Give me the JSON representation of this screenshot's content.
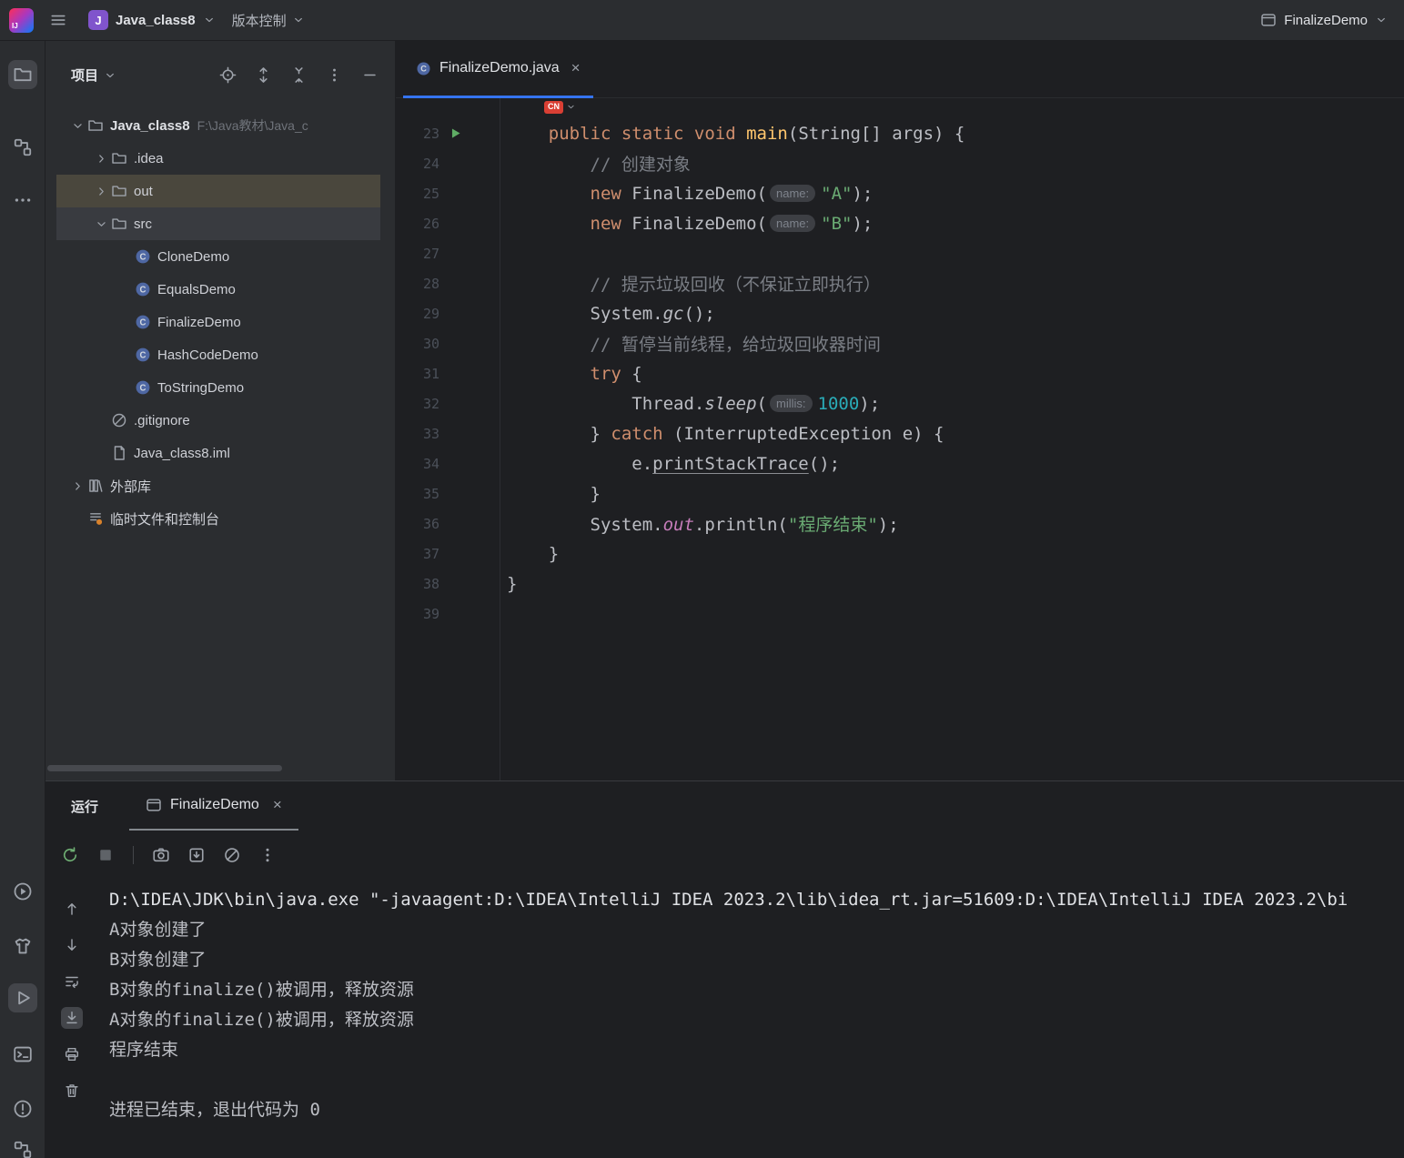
{
  "titlebar": {
    "project_badge": "J",
    "project_name": "Java_class8",
    "vcs_label": "版本控制",
    "run_config": "FinalizeDemo"
  },
  "colors": {
    "accent_blue": "#3574F0",
    "run_green": "#5FAD65",
    "keyword_orange": "#CF8E6D",
    "string_green": "#6AAB73",
    "ime_red": "#D93F34",
    "selection_gray": "#393B40",
    "selection_brown": "#4A473D"
  },
  "left_strip": {
    "top": [
      {
        "id": "project-tool-button",
        "icon": "folder",
        "active": true
      },
      {
        "id": "structure-tool-button",
        "icon": "structure",
        "active": false
      },
      {
        "id": "more-tool-windows-button",
        "icon": "moreDots",
        "active": false
      }
    ],
    "bottom": [
      {
        "id": "services-tool-button",
        "icon": "services",
        "active": false
      },
      {
        "id": "bookmarks-tool-button",
        "icon": "shirt",
        "active": false
      },
      {
        "id": "run-tool-button",
        "icon": "runPlay",
        "active": true
      },
      {
        "id": "terminal-tool-button",
        "icon": "terminal",
        "active": false
      },
      {
        "id": "problems-tool-button",
        "icon": "problems",
        "active": false
      },
      {
        "id": "cutoff-tool-button",
        "icon": "structure",
        "active": false
      }
    ]
  },
  "project_panel": {
    "title": "项目",
    "header_icons": [
      {
        "id": "select-opened-file-button",
        "icon": "target"
      },
      {
        "id": "expand-all-button",
        "icon": "expandAll"
      },
      {
        "id": "collapse-all-button",
        "icon": "collapseAll"
      },
      {
        "id": "more-options-button",
        "icon": "kebab"
      },
      {
        "id": "hide-panel-button",
        "icon": "minus"
      }
    ],
    "tree": [
      {
        "id": "java_class8-root",
        "label": "Java_class8",
        "hint": "F:\\Java教材\\Java_c",
        "icon": "folder",
        "depth": 0,
        "chevron": "down",
        "bold": true
      },
      {
        "id": "idea-folder",
        "label": ".idea",
        "icon": "folder",
        "depth": 1,
        "chevron": "right"
      },
      {
        "id": "out-folder",
        "label": "out",
        "icon": "folder",
        "depth": 1,
        "chevron": "right",
        "selected": "brown"
      },
      {
        "id": "src-folder",
        "label": "src",
        "icon": "folder",
        "depth": 1,
        "chevron": "down",
        "selected": "gray"
      },
      {
        "id": "clonedemo-class",
        "label": "CloneDemo",
        "icon": "class",
        "depth": 2
      },
      {
        "id": "equalsdemo-class",
        "label": "EqualsDemo",
        "icon": "class",
        "depth": 2
      },
      {
        "id": "finalizedemo-class",
        "label": "FinalizeDemo",
        "icon": "class",
        "depth": 2
      },
      {
        "id": "hashcodedemo-class",
        "label": "HashCodeDemo",
        "icon": "class",
        "depth": 2
      },
      {
        "id": "tostringdemo-class",
        "label": "ToStringDemo",
        "icon": "class",
        "depth": 2
      },
      {
        "id": "gitignore-file",
        "label": ".gitignore",
        "icon": "ignored",
        "depth": 1
      },
      {
        "id": "iml-file",
        "label": "Java_class8.iml",
        "icon": "file",
        "depth": 1
      },
      {
        "id": "external-libraries",
        "label": "外部库",
        "icon": "library",
        "depth": 0,
        "chevron": "right"
      },
      {
        "id": "scratches",
        "label": "临时文件和控制台",
        "icon": "scratch",
        "depth": 0
      }
    ]
  },
  "editor": {
    "tab_label": "FinalizeDemo.java",
    "ime_label": "CN",
    "lines": [
      {
        "no": 23,
        "run": true,
        "tokens": [
          {
            "t": "    ",
            "c": "p"
          },
          {
            "t": "public static void ",
            "c": "kw"
          },
          {
            "t": "main",
            "c": "fn"
          },
          {
            "t": "(String[] args) {",
            "c": "p"
          }
        ]
      },
      {
        "no": 24,
        "tokens": [
          {
            "t": "        ",
            "c": "p"
          },
          {
            "t": "// 创建对象",
            "c": "cm"
          }
        ]
      },
      {
        "no": 25,
        "tokens": [
          {
            "t": "        ",
            "c": "p"
          },
          {
            "t": "new",
            "c": "kw"
          },
          {
            "t": " FinalizeDemo(",
            "c": "p"
          },
          {
            "t": "name:",
            "c": "chip"
          },
          {
            "t": "\"A\"",
            "c": "st"
          },
          {
            "t": ");",
            "c": "p"
          }
        ]
      },
      {
        "no": 26,
        "tokens": [
          {
            "t": "        ",
            "c": "p"
          },
          {
            "t": "new",
            "c": "kw"
          },
          {
            "t": " FinalizeDemo(",
            "c": "p"
          },
          {
            "t": "name:",
            "c": "chip"
          },
          {
            "t": "\"B\"",
            "c": "st"
          },
          {
            "t": ");",
            "c": "p"
          }
        ]
      },
      {
        "no": 27,
        "tokens": []
      },
      {
        "no": 28,
        "tokens": [
          {
            "t": "        ",
            "c": "p"
          },
          {
            "t": "// 提示垃圾回收（不保证立即执行）",
            "c": "cm"
          }
        ]
      },
      {
        "no": 29,
        "tokens": [
          {
            "t": "        System.",
            "c": "p"
          },
          {
            "t": "gc",
            "c": "it"
          },
          {
            "t": "();",
            "c": "p"
          }
        ]
      },
      {
        "no": 30,
        "tokens": [
          {
            "t": "        ",
            "c": "p"
          },
          {
            "t": "// 暂停当前线程，给垃圾回收器时间",
            "c": "cm"
          }
        ]
      },
      {
        "no": 31,
        "tokens": [
          {
            "t": "        ",
            "c": "p"
          },
          {
            "t": "try",
            "c": "kw"
          },
          {
            "t": " {",
            "c": "p"
          }
        ]
      },
      {
        "no": 32,
        "tokens": [
          {
            "t": "            Thread.",
            "c": "p"
          },
          {
            "t": "sleep",
            "c": "it"
          },
          {
            "t": "(",
            "c": "p"
          },
          {
            "t": "millis:",
            "c": "chip"
          },
          {
            "t": "1000",
            "c": "nm"
          },
          {
            "t": ");",
            "c": "p"
          }
        ]
      },
      {
        "no": 33,
        "tokens": [
          {
            "t": "        } ",
            "c": "p"
          },
          {
            "t": "catch",
            "c": "kw"
          },
          {
            "t": " (InterruptedException e) {",
            "c": "p"
          }
        ]
      },
      {
        "no": 34,
        "tokens": [
          {
            "t": "            e.",
            "c": "p"
          },
          {
            "t": "printStackTrace",
            "c": "ul"
          },
          {
            "t": "();",
            "c": "p"
          }
        ]
      },
      {
        "no": 35,
        "tokens": [
          {
            "t": "        }",
            "c": "p"
          }
        ]
      },
      {
        "no": 36,
        "tokens": [
          {
            "t": "        System.",
            "c": "p"
          },
          {
            "t": "out",
            "c": "sf"
          },
          {
            "t": ".println(",
            "c": "p"
          },
          {
            "t": "\"程序结束\"",
            "c": "st"
          },
          {
            "t": ");",
            "c": "p"
          }
        ]
      },
      {
        "no": 37,
        "tokens": [
          {
            "t": "    }",
            "c": "p"
          }
        ]
      },
      {
        "no": 38,
        "tokens": [
          {
            "t": "}",
            "c": "p"
          }
        ]
      },
      {
        "no": 39,
        "tokens": []
      }
    ]
  },
  "run_panel": {
    "title": "运行",
    "tab_label": "FinalizeDemo",
    "toolbar": [
      {
        "id": "rerun-button",
        "icon": "rerun"
      },
      {
        "id": "stop-button",
        "icon": "stop"
      },
      {
        "separator": true
      },
      {
        "id": "camera-button",
        "icon": "camera"
      },
      {
        "id": "import-button",
        "icon": "importBox"
      },
      {
        "id": "clear-all-button",
        "icon": "clearAll"
      },
      {
        "id": "kebab-menu-button",
        "icon": "kebab"
      }
    ],
    "gutter": [
      {
        "id": "scroll-up-button",
        "icon": "arrowUp"
      },
      {
        "id": "scroll-down-button",
        "icon": "arrowDown"
      },
      {
        "id": "soft-wrap-button",
        "icon": "softwrap"
      },
      {
        "id": "scroll-to-end-button",
        "icon": "scrollEnd",
        "active": true
      },
      {
        "id": "print-button",
        "icon": "printer"
      },
      {
        "id": "clear-console-button",
        "icon": "trash"
      }
    ],
    "console": [
      {
        "text": "D:\\IDEA\\JDK\\bin\\java.exe \"-javaagent:D:\\IDEA\\IntelliJ IDEA 2023.2\\lib\\idea_rt.jar=51609:D:\\IDEA\\IntelliJ IDEA 2023.2\\bi",
        "cls": "cmd"
      },
      {
        "text": "A对象创建了",
        "cls": "out"
      },
      {
        "text": "B对象创建了",
        "cls": "out"
      },
      {
        "text": "B对象的finalize()被调用，释放资源",
        "cls": "out"
      },
      {
        "text": "A对象的finalize()被调用，释放资源",
        "cls": "out"
      },
      {
        "text": "程序结束",
        "cls": "out"
      },
      {
        "text": "",
        "cls": "out"
      },
      {
        "text": "进程已结束，退出代码为 0",
        "cls": "out"
      }
    ]
  }
}
